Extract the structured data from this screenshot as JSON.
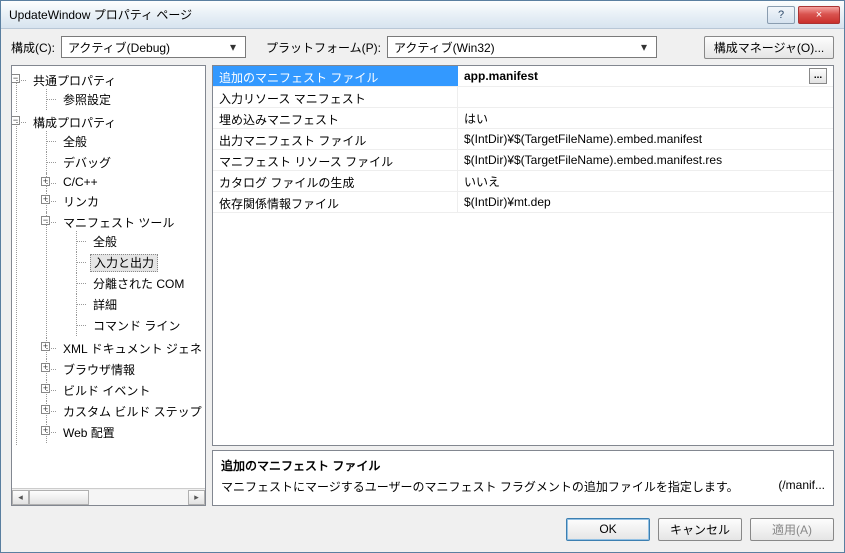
{
  "window": {
    "title": "UpdateWindow プロパティ ページ"
  },
  "titlebar": {
    "help": "?",
    "close": "×"
  },
  "configRow": {
    "configLabel": "構成(C):",
    "configValue": "アクティブ(Debug)",
    "platformLabel": "プラットフォーム(P):",
    "platformValue": "アクティブ(Win32)",
    "managerBtn": "構成マネージャ(O)..."
  },
  "tree": {
    "common": {
      "label": "共通プロパティ",
      "ref": "参照設定"
    },
    "config": {
      "label": "構成プロパティ",
      "general": "全般",
      "debug": "デバッグ",
      "cpp": "C/C++",
      "linker": "リンカ",
      "manifest": {
        "label": "マニフェスト ツール",
        "general": "全般",
        "io": "入力と出力",
        "com": "分離された COM",
        "advanced": "詳細",
        "cmd": "コマンド ライン"
      },
      "xml": "XML ドキュメント ジェネ",
      "browse": "ブラウザ情報",
      "build": "ビルド イベント",
      "custom": "カスタム ビルド ステップ",
      "web": "Web 配置"
    }
  },
  "props": [
    {
      "name": "追加のマニフェスト ファイル",
      "value": "app.manifest",
      "selected": true,
      "browse": true
    },
    {
      "name": "入力リソース マニフェスト",
      "value": ""
    },
    {
      "name": "埋め込みマニフェスト",
      "value": "はい"
    },
    {
      "name": "出力マニフェスト ファイル",
      "value": "$(IntDir)¥$(TargetFileName).embed.manifest"
    },
    {
      "name": "マニフェスト リソース ファイル",
      "value": "$(IntDir)¥$(TargetFileName).embed.manifest.res"
    },
    {
      "name": "カタログ ファイルの生成",
      "value": "いいえ"
    },
    {
      "name": "依存関係情報ファイル",
      "value": "$(IntDir)¥mt.dep"
    }
  ],
  "desc": {
    "title": "追加のマニフェスト ファイル",
    "body": "マニフェストにマージするユーザーのマニフェスト フラグメントの追加ファイルを指定します。",
    "flag": "(/manif..."
  },
  "footer": {
    "ok": "OK",
    "cancel": "キャンセル",
    "apply": "適用(A)"
  }
}
